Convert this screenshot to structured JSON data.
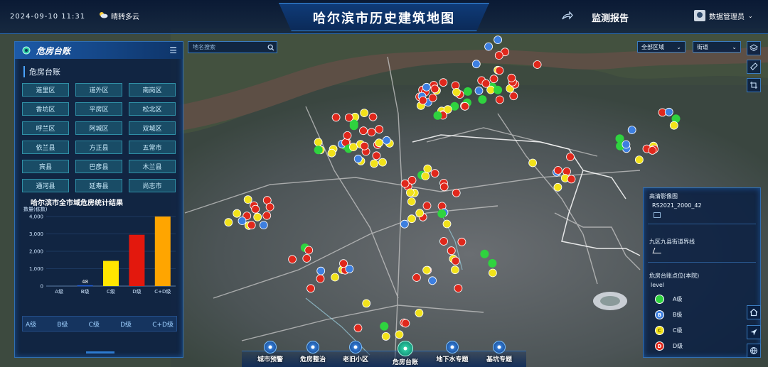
{
  "header": {
    "datetime": "2024-09-10  11:31",
    "weather": "晴转多云",
    "title": "哈尔滨市历史建筑地图",
    "report_label": "监测报告",
    "user_label": "数据管理员"
  },
  "left_panel": {
    "title": "危房台账",
    "subtitle": "危房台账",
    "districts": [
      "道里区",
      "道外区",
      "南岗区",
      "香坊区",
      "平房区",
      "松北区",
      "呼兰区",
      "阿城区",
      "双城区",
      "依兰县",
      "方正县",
      "五常市",
      "宾县",
      "巴彦县",
      "木兰县",
      "通河县",
      "延寿县",
      "尚志市"
    ],
    "grade_tabs": [
      "A级",
      "B级",
      "C级",
      "D级",
      "C+D级"
    ]
  },
  "search": {
    "placeholder": "地名搜索"
  },
  "dropdowns": {
    "area": "全部区域",
    "street": "街道"
  },
  "right_panel": {
    "basemap_title": "高清影像图",
    "basemap_value": "RS2021_2000_42",
    "boundary_label": "九区九县街道界线",
    "points_title": "危房台账点位(本院)",
    "field_label": "level",
    "legend": [
      {
        "label": "A级",
        "letter": "",
        "color": "#2fd33f"
      },
      {
        "label": "B级",
        "letter": "B",
        "color": "#3d7fe0"
      },
      {
        "label": "C级",
        "letter": "C",
        "color": "#f2e21a"
      },
      {
        "label": "D级",
        "letter": "D",
        "color": "#e0281c"
      }
    ]
  },
  "bottom_nav": [
    "城市预警",
    "危房整治",
    "老旧小区",
    "危房台账",
    "地下水专题",
    "基坑专题"
  ],
  "chart_data": {
    "type": "bar",
    "title": "哈尔滨市全市域危房统计结果",
    "ylabel": "数量(栋数)",
    "categories": [
      "A级",
      "B级",
      "C级",
      "D级",
      "C+D级"
    ],
    "values": [
      0,
      48,
      1450,
      2950,
      4000
    ],
    "value_labels": [
      "",
      "48",
      "",
      "",
      ""
    ],
    "colors": [
      "#2fd33f",
      "#1f5bd8",
      "#ffe600",
      "#e3180d",
      "#ffa500"
    ],
    "ylim": [
      0,
      4000
    ],
    "yticks": [
      "0",
      "1,000",
      "2,000",
      "3,000",
      "4,000"
    ]
  },
  "map": {
    "colors": {
      "river": "#5e5047",
      "land": "#3a4640",
      "dense": "#5c6268",
      "roads": "#d8d8d8"
    }
  }
}
